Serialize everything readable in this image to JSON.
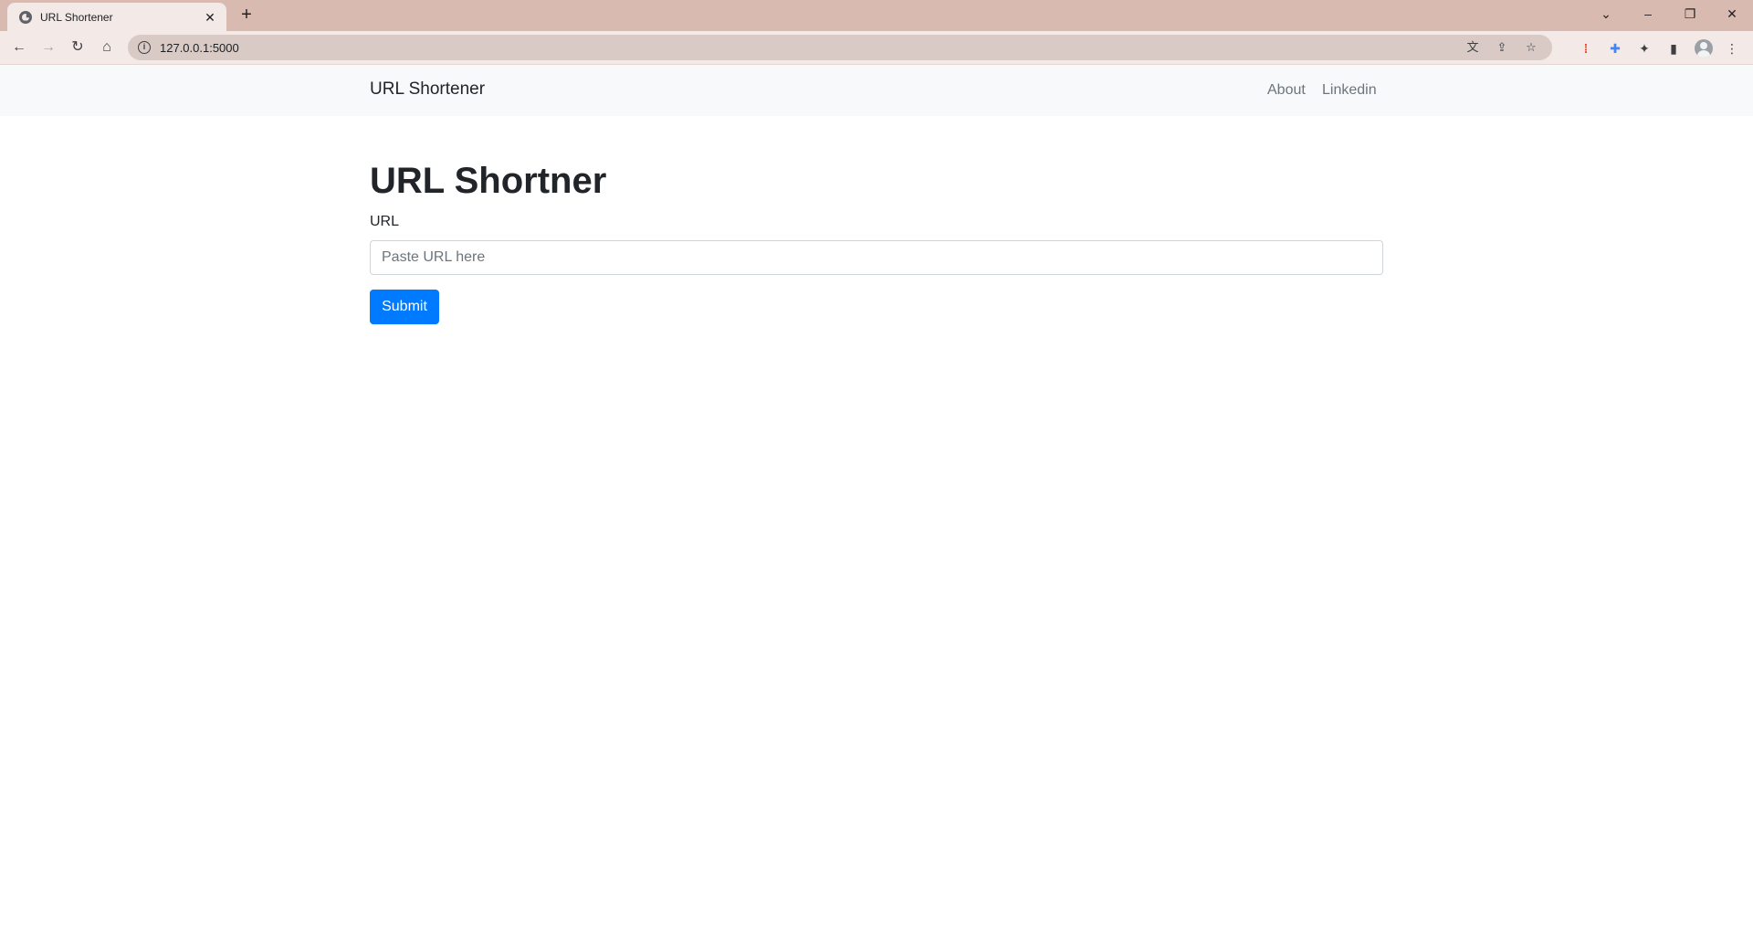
{
  "browser": {
    "tab_title": "URL Shortener",
    "tab_close": "✕",
    "new_tab": "+",
    "address": "127.0.0.1:5000",
    "window_controls": {
      "dropdown": "⌄",
      "minimize": "–",
      "restore": "❐",
      "close": "✕"
    },
    "nav": {
      "back": "←",
      "forward": "→",
      "reload": "↻",
      "home": "⌂"
    },
    "icons": {
      "translate": "文",
      "share": "⇪",
      "bookmark": "☆",
      "extensions": "✦",
      "side_panel": "▮",
      "menu": "⋮"
    }
  },
  "navbar": {
    "brand": "URL Shortener",
    "links": [
      "About",
      "Linkedin"
    ]
  },
  "main": {
    "title": "URL Shortner",
    "url_label": "URL",
    "url_placeholder": "Paste URL here",
    "submit_label": "Submit"
  },
  "colors": {
    "tab_strip": "#d8bab1",
    "toolbar": "#f3e9e6",
    "navbar_bg": "#f8f9fa",
    "primary": "#007bff"
  }
}
